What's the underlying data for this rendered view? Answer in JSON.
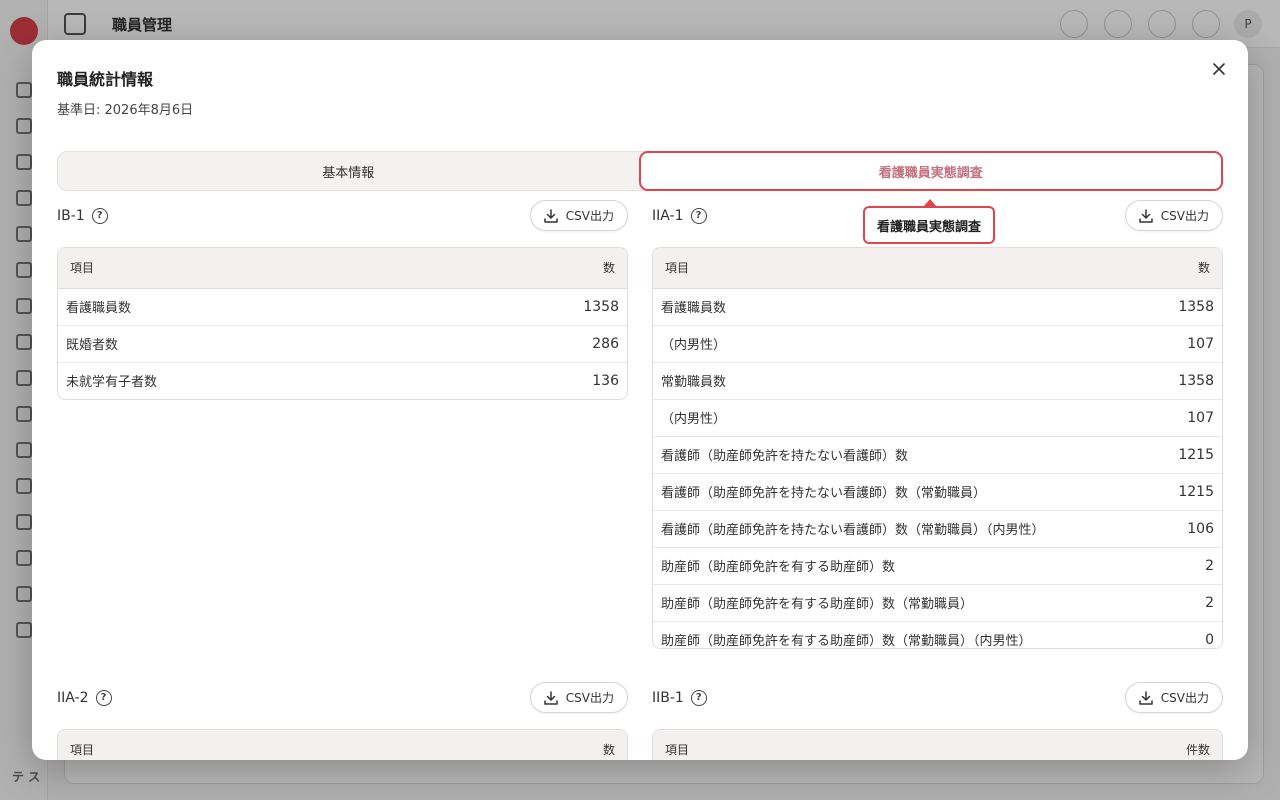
{
  "background": {
    "header_title": "職員管理",
    "avatar_initial": "P",
    "sidebar_footer": "テ ス"
  },
  "dialog": {
    "title": "職員統計情報",
    "subtitle": "基準日: 2026年8月6日",
    "close_icon": "close-icon"
  },
  "tabs": [
    {
      "label": "基本情報",
      "active": false
    },
    {
      "label": "看護職員実態調査",
      "active": true
    }
  ],
  "tooltip": "看護職員実態調査",
  "colors": {
    "accent": "#e0454d",
    "active_tab_text": "#c37480"
  },
  "csv_label": "CSV出力",
  "sections": {
    "ib1": {
      "title": "IB-1",
      "col_item": "項目",
      "col_value": "数",
      "rows": [
        {
          "label": "看護職員数",
          "value": "1358"
        },
        {
          "label": "既婚者数",
          "value": "286"
        },
        {
          "label": "未就学有子者数",
          "value": "136"
        }
      ]
    },
    "iia1": {
      "title": "IIA-1",
      "col_item": "項目",
      "col_value": "数",
      "rows": [
        {
          "label": "看護職員数",
          "value": "1358"
        },
        {
          "label": "（内男性）",
          "value": "107"
        },
        {
          "label": "常勤職員数",
          "value": "1358"
        },
        {
          "label": "（内男性）",
          "value": "107"
        },
        {
          "label": "看護師（助産師免許を持たない看護師）数",
          "value": "1215"
        },
        {
          "label": "看護師（助産師免許を持たない看護師）数（常勤職員）",
          "value": "1215"
        },
        {
          "label": "看護師（助産師免許を持たない看護師）数（常勤職員）（内男性）",
          "value": "106"
        },
        {
          "label": "助産師（助産師免許を有する助産師）数",
          "value": "2"
        },
        {
          "label": "助産師（助産師免許を有する助産師）数（常勤職員）",
          "value": "2"
        },
        {
          "label": "助産師（助産師免許を有する助産師）数（常勤職員）（内男性）",
          "value": "0"
        }
      ]
    },
    "iia2": {
      "title": "IIA-2",
      "col_item": "項目",
      "col_value": "数"
    },
    "iib1": {
      "title": "IIB-1",
      "col_item": "項目",
      "col_value": "件数"
    }
  }
}
